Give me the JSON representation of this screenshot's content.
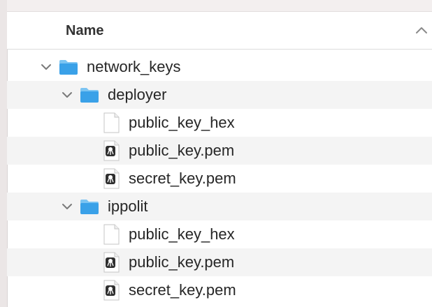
{
  "header": {
    "name_column": "Name"
  },
  "tree": [
    {
      "kind": "folder",
      "depth": 0,
      "expanded": true,
      "label": "network_keys",
      "icon": "folder-icon"
    },
    {
      "kind": "folder",
      "depth": 1,
      "expanded": true,
      "label": "deployer",
      "icon": "folder-icon"
    },
    {
      "kind": "file",
      "depth": 2,
      "label": "public_key_hex",
      "icon": "document-icon"
    },
    {
      "kind": "file",
      "depth": 2,
      "label": "public_key.pem",
      "icon": "certificate-icon"
    },
    {
      "kind": "file",
      "depth": 2,
      "label": "secret_key.pem",
      "icon": "certificate-icon"
    },
    {
      "kind": "folder",
      "depth": 1,
      "expanded": true,
      "label": "ippolit",
      "icon": "folder-icon"
    },
    {
      "kind": "file",
      "depth": 2,
      "label": "public_key_hex",
      "icon": "document-icon"
    },
    {
      "kind": "file",
      "depth": 2,
      "label": "public_key.pem",
      "icon": "certificate-icon"
    },
    {
      "kind": "file",
      "depth": 2,
      "label": "secret_key.pem",
      "icon": "certificate-icon"
    }
  ],
  "colors": {
    "folder": "#3aa1e8",
    "folder_tab": "#7cc4f2",
    "row_alt": "#f4f4f4",
    "text": "#262626"
  }
}
